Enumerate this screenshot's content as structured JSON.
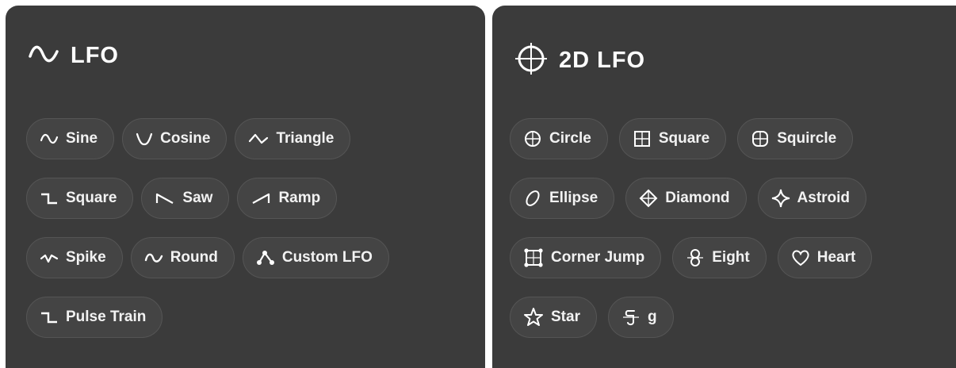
{
  "lfo_panel": {
    "title": "LFO",
    "icon": "sine-wave-icon",
    "rows": [
      [
        {
          "label": "Sine",
          "icon": "sine-icon"
        },
        {
          "label": "Cosine",
          "icon": "cosine-icon"
        },
        {
          "label": "Triangle",
          "icon": "triangle-wave-icon"
        }
      ],
      [
        {
          "label": "Square",
          "icon": "square-wave-icon"
        },
        {
          "label": "Saw",
          "icon": "saw-wave-icon"
        },
        {
          "label": "Ramp",
          "icon": "ramp-wave-icon"
        }
      ],
      [
        {
          "label": "Spike",
          "icon": "spike-wave-icon"
        },
        {
          "label": "Round",
          "icon": "round-wave-icon"
        },
        {
          "label": "Custom LFO",
          "icon": "custom-lfo-icon"
        }
      ],
      [
        {
          "label": "Pulse Train",
          "icon": "pulse-train-icon"
        }
      ]
    ]
  },
  "lfo2d_panel": {
    "title": "2D LFO",
    "icon": "crosshair-circle-icon",
    "rows": [
      [
        {
          "label": "Circle",
          "icon": "circle-icon"
        },
        {
          "label": "Square",
          "icon": "square-icon"
        },
        {
          "label": "Squircle",
          "icon": "squircle-icon"
        }
      ],
      [
        {
          "label": "Ellipse",
          "icon": "ellipse-icon"
        },
        {
          "label": "Diamond",
          "icon": "diamond-icon"
        },
        {
          "label": "Astroid",
          "icon": "astroid-icon"
        }
      ],
      [
        {
          "label": "Corner Jump",
          "icon": "corner-jump-icon"
        },
        {
          "label": "Eight",
          "icon": "figure-eight-icon"
        },
        {
          "label": "Heart",
          "icon": "heart-icon"
        }
      ],
      [
        {
          "label": "Star",
          "icon": "star-icon"
        },
        {
          "label": "g",
          "icon": "g-shape-icon"
        }
      ]
    ]
  },
  "colors": {
    "panel_bg": "#3b3b3b",
    "chip_bg": "#444444",
    "chip_border": "#555555",
    "text": "#f2f2f2"
  }
}
